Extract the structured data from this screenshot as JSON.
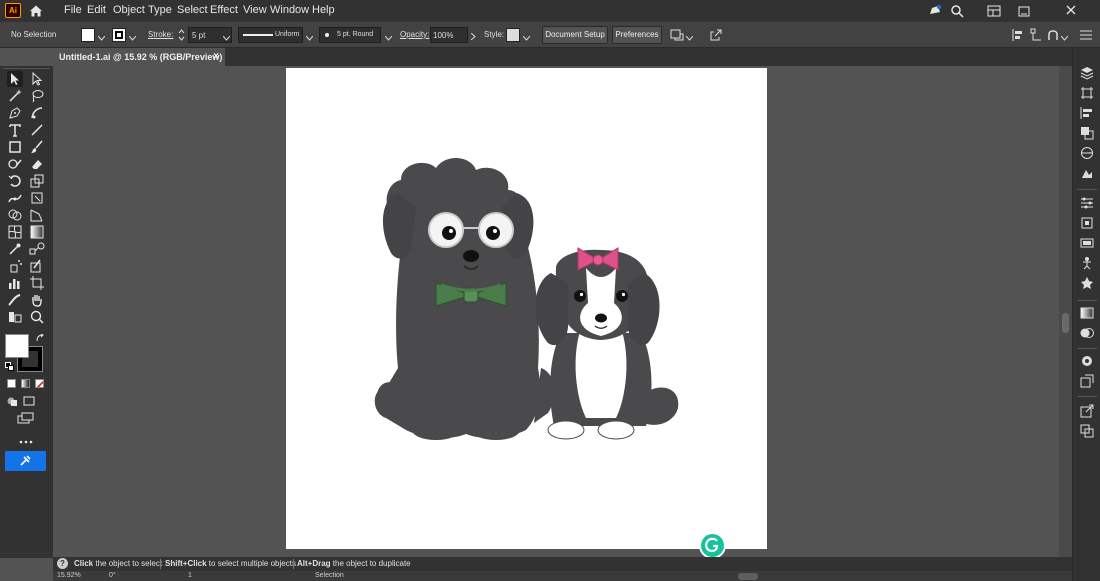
{
  "app": {
    "logo": "Ai",
    "home_icon": "home-icon"
  },
  "menu": [
    "File",
    "Edit",
    "Object",
    "Type",
    "Select",
    "Effect",
    "View",
    "Window",
    "Help"
  ],
  "control": {
    "selection": "No Selection",
    "stroke_label": "Stroke:",
    "stroke_weight": "5 pt",
    "profile": "Uniform",
    "brush": "5 pt. Round",
    "opacity_label": "Opacity:",
    "opacity_value": "100%",
    "style_label": "Style:",
    "document_setup": "Document Setup",
    "preferences": "Preferences"
  },
  "document": {
    "tab_title": "Untitled-1.ai @ 15.92 % (RGB/Preview)",
    "close": "×"
  },
  "status": {
    "hint_1_bold": "Click",
    "hint_1": " the object to select",
    "hint_2_bold": "Shift+Click",
    "hint_2": " to select multiple objects",
    "hint_3_bold": "Alt+Drag",
    "hint_3": " the object to duplicate"
  },
  "bottom": {
    "zoom": "15.92%",
    "rotation": "0°",
    "artboard": "1",
    "tool": "Selection"
  },
  "colors": {
    "fill": "#ffffff",
    "stroke": "#000000",
    "accent": "#1473e6",
    "dog_dark": "#4a4a4c",
    "bow_green": "#4a7d4a",
    "bow_pink": "#e0508a"
  }
}
